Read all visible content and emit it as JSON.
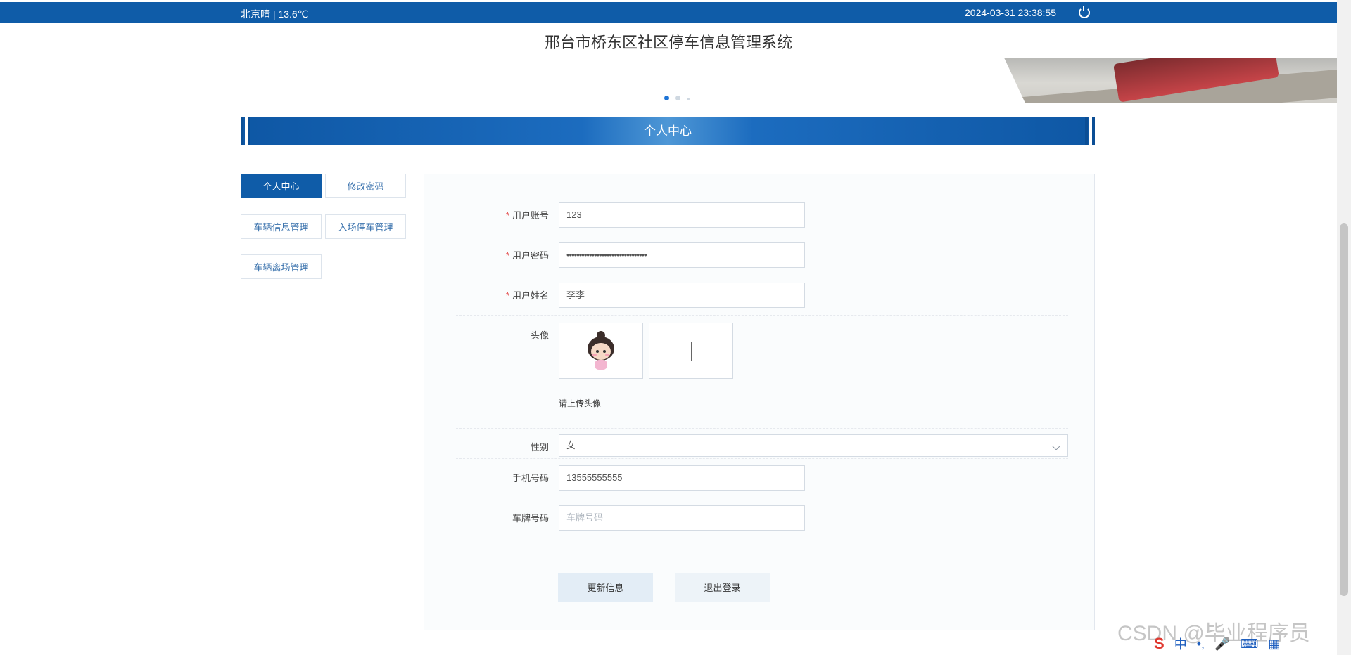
{
  "topbar": {
    "weather": "北京晴 | 13.6℃",
    "datetime": "2024-03-31   23:38:55"
  },
  "system_title": "邢台市桥东区社区停车信息管理系统",
  "section_title": "个人中心",
  "menu": [
    {
      "label": "个人中心",
      "active": true
    },
    {
      "label": "修改密码"
    },
    {
      "label": "车辆信息管理"
    },
    {
      "label": "入场停车管理"
    },
    {
      "label": "车辆离场管理"
    }
  ],
  "form": {
    "account": {
      "label": "用户账号",
      "required": true,
      "value": "123"
    },
    "password": {
      "label": "用户密码",
      "required": true,
      "value": "••••••••••••••••••••••••••••••••"
    },
    "name": {
      "label": "用户姓名",
      "required": true,
      "value": "李李"
    },
    "avatar": {
      "label": "头像",
      "hint": "请上传头像"
    },
    "gender": {
      "label": "性别",
      "value": "女"
    },
    "phone": {
      "label": "手机号码",
      "value": "13555555555"
    },
    "plate": {
      "label": "车牌号码",
      "placeholder": "车牌号码"
    }
  },
  "buttons": {
    "update": "更新信息",
    "logout": "退出登录"
  },
  "watermark": "CSDN @毕业程序员",
  "tray": {
    "ime": "中",
    "punct": "•,"
  }
}
